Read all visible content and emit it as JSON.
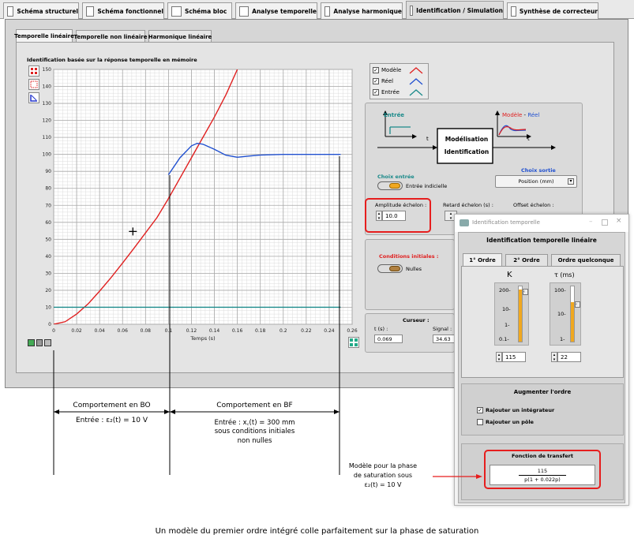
{
  "top_tabs": [
    {
      "label": "Schéma structurel",
      "icon": "gear-icon"
    },
    {
      "label": "Schéma fonctionnel",
      "icon": "blocks-icon"
    },
    {
      "label": "Schéma bloc",
      "icon": "pencil-icon"
    },
    {
      "label": "Analyse temporelle",
      "icon": "step-response-icon"
    },
    {
      "label": "Analyse harmonique",
      "icon": "bode-icon"
    },
    {
      "label": "Identification  / Simulation",
      "icon": "people-icon"
    },
    {
      "label": "Synthèse de correcteur",
      "icon": "calculator-icon"
    }
  ],
  "sub_tabs": [
    "Temporelle linéaire",
    "Temporelle non linéaire",
    "Harmonique linéaire"
  ],
  "graph": {
    "title": "Identification basée sur la réponse temporelle en mémoire",
    "xlabel": "Temps (s)"
  },
  "legend": [
    {
      "label": "Modèle",
      "color": "#e02020",
      "checked": true
    },
    {
      "label": "Réel",
      "color": "#2050d0",
      "checked": true
    },
    {
      "label": "Entrée",
      "color": "#1a8a8a",
      "checked": true
    }
  ],
  "chart_data": {
    "type": "line",
    "title": "Identification basée sur la réponse temporelle en mémoire",
    "xlabel": "Temps (s)",
    "ylabel": "",
    "xlim": [
      0,
      0.26
    ],
    "ylim": [
      0,
      150
    ],
    "x_ticks": [
      "0",
      "0.02",
      "0.04",
      "0.06",
      "0.08",
      "0.1",
      "0.12",
      "0.14",
      "0.16",
      "0.18",
      "0.2",
      "0.22",
      "0.24",
      "0.26"
    ],
    "y_ticks": [
      "0",
      "10",
      "20",
      "30",
      "40",
      "50",
      "60",
      "70",
      "80",
      "90",
      "100",
      "110",
      "120",
      "130",
      "140",
      "150"
    ],
    "series": [
      {
        "name": "Modèle",
        "color": "#e02020",
        "x": [
          0,
          0.01,
          0.02,
          0.03,
          0.04,
          0.05,
          0.06,
          0.07,
          0.08,
          0.09,
          0.1,
          0.11,
          0.12,
          0.13,
          0.14,
          0.15,
          0.16
        ],
        "y": [
          0,
          1.5,
          6,
          12,
          19.5,
          27.5,
          36,
          44.8,
          53.8,
          62.8,
          74,
          86,
          98,
          110,
          122,
          135,
          150
        ]
      },
      {
        "name": "Réel",
        "color": "#2050d0",
        "x": [
          0.1,
          0.11,
          0.12,
          0.125,
          0.13,
          0.14,
          0.15,
          0.16,
          0.17,
          0.18,
          0.2,
          0.22,
          0.25
        ],
        "y": [
          88,
          98,
          105,
          106.5,
          106,
          103,
          99.5,
          98.3,
          99,
          99.6,
          100,
          100,
          100
        ]
      },
      {
        "name": "Entrée",
        "color": "#1a8a8a",
        "x": [
          0,
          0.25
        ],
        "y": [
          10,
          10
        ]
      }
    ],
    "cursor": {
      "x": 0.069,
      "y": 54.63
    }
  },
  "identification_diagram": {
    "input_label": "Entrée",
    "t_label": "t",
    "block_line1": "Modélisation",
    "block_line2": "Identification",
    "output_label_model": "Modèle",
    "output_label_sep": " - ",
    "output_label_real": "Réel"
  },
  "choix_entree": {
    "title": "Choix entrée",
    "toggle_label": "Entrée indicielle"
  },
  "choix_sortie": {
    "title": "Choix sortie",
    "value": "Position (mm)"
  },
  "amplitude": {
    "label": "Amplitude échelon :",
    "value": "10.0"
  },
  "retard": {
    "label": "Retard échelon (s) :"
  },
  "offset": {
    "label": "Offset échelon :"
  },
  "conditions": {
    "title": "Conditions initiales :",
    "toggle_label": "Nulles"
  },
  "curseur": {
    "title": "Curseur :",
    "t_label": "t (s) :",
    "t_value": "0.069",
    "signal_label": "Signal :",
    "signal_value": "34.63"
  },
  "dialog": {
    "title": "Identification temporelle",
    "header": "Identification temporelle linéaire",
    "tabs": [
      "1° Ordre",
      "2° Ordre",
      "Ordre quelconque"
    ],
    "k_label": "K",
    "tau_label": "τ (ms)",
    "k_scale": [
      "200-",
      "10-",
      "1-",
      "0.1-"
    ],
    "tau_scale": [
      "100-",
      "10-",
      "1-"
    ],
    "k_value": "115",
    "tau_value": "22",
    "augmenter": "Augmenter l'ordre",
    "integrateur": {
      "label": "Rajouter un intégrateur",
      "checked": true
    },
    "pole": {
      "label": "Rajouter un pôle",
      "checked": false
    },
    "fonction_title": "Fonction de transfert",
    "fonction_num": "115",
    "fonction_den": "p(1 + 0.022p)"
  },
  "annotations": {
    "bo": "Comportement en BO",
    "bo_input": "Entrée : ε₂(t) = 10 V",
    "bf": "Comportement en BF",
    "bf_input1": "Entrée : x꜀(t) = 300 mm",
    "bf_input2": "sous conditions initiales",
    "bf_input3": "non nulles",
    "model1": "Modèle pour la phase",
    "model2": "de saturation sous",
    "model3": "ε₂(t) = 10 V",
    "caption": "Un modèle du premier ordre intégré colle parfaitement sur la phase de saturation"
  }
}
